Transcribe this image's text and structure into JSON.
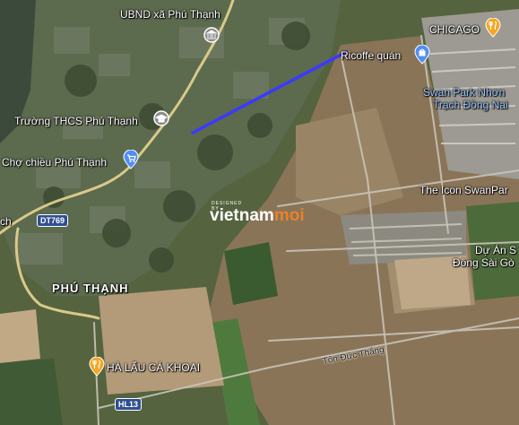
{
  "map": {
    "places": {
      "ubnd": "UBND xã Phú Thạnh",
      "truong": "Trường THCS Phú Thạnh",
      "cho": "Chợ chiều Phú Thạnh",
      "chicago": "CHICAGO",
      "ricoffe": "Ricoffe quán",
      "swanpark_line1": "Swan Park Nhơn",
      "swanpark_line2": "Trạch Đồng Nai",
      "theicon": "The Icon SwanPar",
      "duan_line1": "Dự Án S",
      "duan_line2": "Đông Sài Gò",
      "phuthanh": "PHÚ THẠNH",
      "halau": "HÀ LẨU CÁ KHOAI",
      "edge_ch": "ch"
    },
    "roads": {
      "dt769": "DT769",
      "hl13": "HL13",
      "tonducthang": "Tôn Đức Thắng"
    },
    "watermark": {
      "designed_by": "DESIGNED BY",
      "brand_main": "vietnam",
      "brand_accent": "moi"
    },
    "colors": {
      "route": "#3a3aff",
      "pin_red": "#e8453c",
      "pin_blue": "#4f8ff7",
      "pin_orange": "#f5a623",
      "pin_gray": "#8a8a8a",
      "watermark_accent": "#e8832a"
    },
    "icons": {
      "ubnd": "government-building-icon",
      "truong": "school-icon",
      "cho": "shopping-cart-icon",
      "chicago": "restaurant-icon",
      "ricoffe": "shopping-bag-icon",
      "halau": "restaurant-icon"
    }
  }
}
